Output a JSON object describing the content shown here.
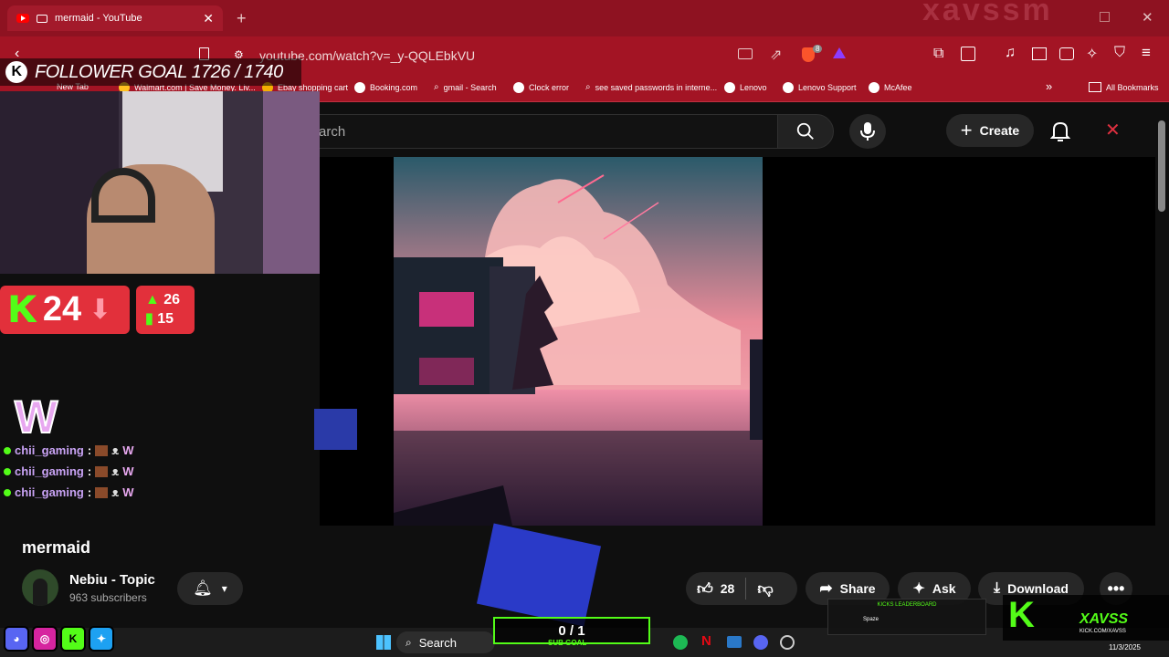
{
  "browser": {
    "tab_title": "mermaid - YouTube",
    "new_tab_icon": "+",
    "url": "youtube.com/watch?v=_y-QQLEbkVU",
    "brave_badge": "8",
    "bookmarks": [
      {
        "label": "New Tab"
      },
      {
        "label": "Walmart.com | Save Money. Liv..."
      },
      {
        "label": "Ebay shopping cart"
      },
      {
        "label": "Booking.com"
      },
      {
        "label": "gmail - Search"
      },
      {
        "label": "Clock error"
      },
      {
        "label": "see saved passwords in interne..."
      },
      {
        "label": "Lenovo"
      },
      {
        "label": "Lenovo Support"
      },
      {
        "label": "McAfee"
      }
    ],
    "all_bookmarks": "All Bookmarks",
    "window_watermark": "xavssm"
  },
  "youtube": {
    "search_placeholder": "arch",
    "create_label": "Create",
    "video_title": "mermaid",
    "channel_name": "Nebiu - Topic",
    "subscribers": "963 subscribers",
    "like_count": "28",
    "share_label": "Share",
    "ask_label": "Ask",
    "download_label": "Download"
  },
  "overlay": {
    "follower_goal": "FOLLOWER GOAL 1726 / 1740",
    "k_letter": "K",
    "viewer_count": "24",
    "stat_up": "26",
    "stat_bars": "15",
    "w_emote": "W",
    "chat": [
      {
        "user": "chii_gaming",
        "msg": "W"
      },
      {
        "user": "chii_gaming",
        "msg": "W"
      },
      {
        "user": "chii_gaming",
        "msg": "W"
      }
    ],
    "sub_goal": "0 / 1",
    "sub_goal_label": "SUB GOAL",
    "leaderboard_title": "KICKS LEADERBOARD",
    "leaderboard_row": "Spaze",
    "brand": "XAVSS",
    "brand_sub": "KICK.COM/XAVSS"
  },
  "taskbar": {
    "search_label": "Search",
    "date": "11/3/2025"
  },
  "colors": {
    "browser_red": "#a31424",
    "kick_green": "#53fc18",
    "overlay_red": "#e2303b"
  }
}
